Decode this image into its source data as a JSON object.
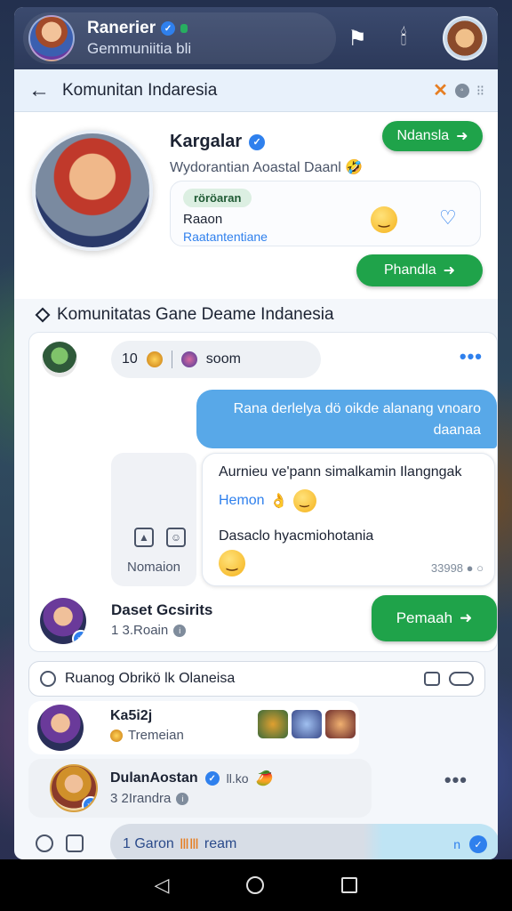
{
  "topbar": {
    "name": "Ranerier",
    "subtitle": "Gemmuniitia bli"
  },
  "header": {
    "title": "Komunitan Indaresia"
  },
  "profile": {
    "name": "Kargalar",
    "subtitle": "Wydorantian Aoastal Daanl",
    "top_button": "Ndansla",
    "chip": "röröaran",
    "line1": "Raaon",
    "line2": "Raatantentiane",
    "mid_button": "Phandla"
  },
  "community": {
    "title": "Komunitatas Gane Deame Indanesia",
    "count": "10",
    "pill_label": "soom",
    "outgoing_message": "Rana derlelya dö oikde alanang vnoaro daanaa",
    "left_card_label": "Nomaion",
    "incoming_line1": "Aurnieu ve'pann simalkamin Ilangngak",
    "incoming_line2": "Hemon",
    "incoming_line3": "Dasaclo hyacmiohotania",
    "message_time": "33998",
    "member_name": "Daset Gcsirits",
    "member_sub": "1 3.Roain",
    "join_button": "Pemaah"
  },
  "search": {
    "value": "Ruanog Obrikö lk Olaneisa"
  },
  "list": [
    {
      "name": "Ka5i2j",
      "sub": "Tremeian"
    },
    {
      "name": "DulanAostan",
      "tag": "ll.ko",
      "sub": "3 2Irandra"
    }
  ],
  "composer": {
    "text": "1 Garon",
    "suffix": "ream",
    "right_label": "n"
  },
  "colors": {
    "accent_green": "#1fa34a",
    "accent_blue": "#2f80ed",
    "bubble_blue": "#58a8e8"
  }
}
